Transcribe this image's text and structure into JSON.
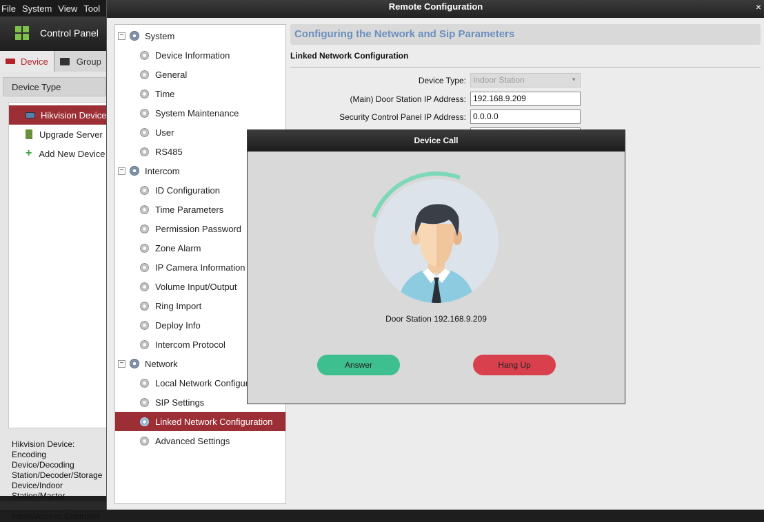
{
  "main_app": {
    "menu": [
      "File",
      "System",
      "View",
      "Tool"
    ],
    "control_panel_label": "Control Panel",
    "tabs": {
      "device": "Device",
      "group": "Group"
    },
    "device_type_header": "Device Type",
    "device_types": [
      {
        "label": "Hikvision Device",
        "selected": true
      },
      {
        "label": "Upgrade Server",
        "selected": false
      },
      {
        "label": "Add New Device Type",
        "selected": false
      }
    ],
    "description": "Hikvision Device: Encoding Device/Decoding Station/Decoder/Storage Device/Indoor Station/Master Station/Security Control Panel/Access Controller"
  },
  "remote_config": {
    "title": "Remote Configuration",
    "close_glyph": "×",
    "tree": [
      {
        "group": "System",
        "items": [
          "Device Information",
          "General",
          "Time",
          "System Maintenance",
          "User",
          "RS485"
        ]
      },
      {
        "group": "Intercom",
        "items": [
          "ID Configuration",
          "Time Parameters",
          "Permission Password",
          "Zone Alarm",
          "IP Camera Information",
          "Volume Input/Output",
          "Ring Import",
          "Deploy Info",
          "Intercom Protocol"
        ]
      },
      {
        "group": "Network",
        "items": [
          "Local Network Configuration",
          "SIP Settings",
          "Linked Network Configuration",
          "Advanced Settings"
        ]
      }
    ],
    "selected_item": "Linked Network Configuration",
    "content_title": "Configuring the Network and Sip Parameters",
    "section_title": "Linked Network Configuration",
    "fields": {
      "device_type": {
        "label": "Device Type:",
        "value": "Indoor Station"
      },
      "door_station_ip": {
        "label": "(Main) Door Station IP Address:",
        "value": "192.168.9.209"
      },
      "security_panel_ip": {
        "label": "Security Control Panel IP Address:",
        "value": "0.0.0.0"
      }
    }
  },
  "device_call": {
    "title": "Device Call",
    "caller": "Door Station 192.168.9.209",
    "answer_label": "Answer",
    "hangup_label": "Hang Up",
    "colors": {
      "answer": "#3dbf8f",
      "hangup": "#d9404d",
      "ring": "#7dd8b8"
    }
  }
}
